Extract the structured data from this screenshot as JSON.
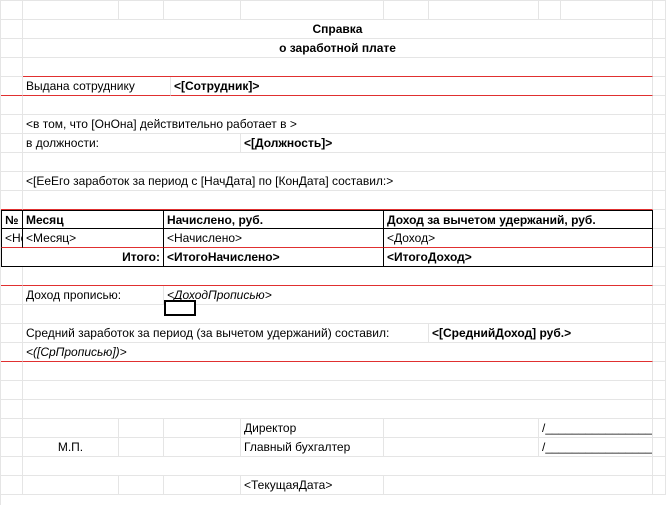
{
  "header": {
    "title": "Справка",
    "subtitle": "о заработной плате"
  },
  "issued": {
    "label": "Выдана сотруднику",
    "value": "<[Сотрудник]>"
  },
  "works": {
    "line1": "<в том, что [ОнОна] действительно работает в >",
    "position_label": "в должности:",
    "position_value": "<[Должность]>"
  },
  "earnings_period": "<[ЕеЕго заработок за период с [НачДата] по [КонДата] составил:>",
  "table": {
    "headers": {
      "num": "№",
      "month": "Месяц",
      "accrued": "Начислено, руб.",
      "income": "Доход за вычетом удержаний, руб."
    },
    "data_row": {
      "num": "<Ном",
      "month": "<Месяц>",
      "accrued": "<Начислено>",
      "income": "<Доход>"
    },
    "total": {
      "label": "Итого:",
      "accrued": "<ИтогоНачислено>",
      "income": "<ИтогоДоход>"
    }
  },
  "income_words": {
    "label": "Доход прописью:",
    "value": "<ДоходПрописью>"
  },
  "average": {
    "label": "Средний заработок за период (за вычетом удержаний) составил:",
    "value": "<[СреднийДоход] руб.>",
    "words": "<([СрПрописью])>"
  },
  "signatures": {
    "mp": "М.П.",
    "director": "Директор",
    "accountant": "Главный бухгалтер"
  },
  "footer": {
    "date": "<ТекущаяДата>"
  }
}
